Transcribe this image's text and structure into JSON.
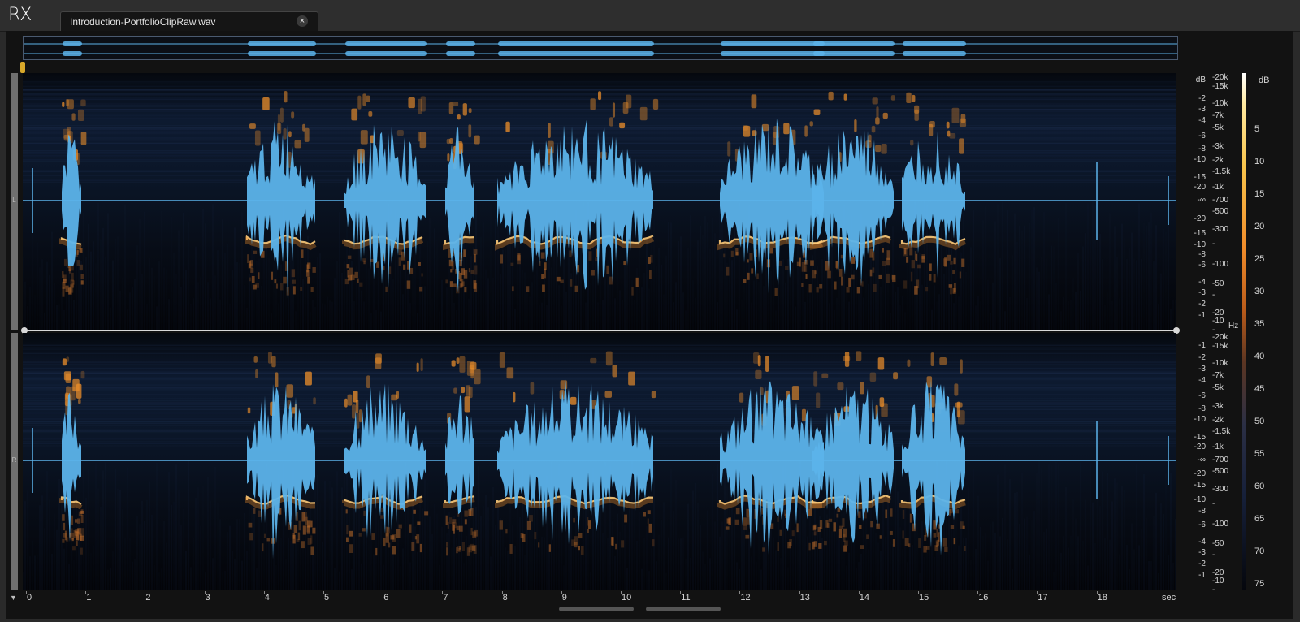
{
  "app": {
    "logo": "RX"
  },
  "tab": {
    "filename": "Introduction-PortfolioClipRaw.wav",
    "close_label": "×"
  },
  "channels": {
    "left_label": "L",
    "right_label": "R"
  },
  "db_axis": {
    "header": "dB",
    "left_ticks": [
      "-2",
      "-3",
      "-4",
      "-6",
      "-8",
      "-10",
      "-15",
      "-20",
      "-∞",
      "-20",
      "-15",
      "-10",
      "-8",
      "-6",
      "-4",
      "-3",
      "-2",
      "-1"
    ],
    "right_ticks": [
      "-1",
      "-2",
      "-3",
      "-4",
      "-6",
      "-8",
      "-10",
      "-15",
      "-20",
      "-∞",
      "-20",
      "-15",
      "-10",
      "-8",
      "-6",
      "-4",
      "-3",
      "-2",
      "-1"
    ]
  },
  "hz_axis": {
    "unit": "Hz",
    "left_ticks": [
      "-20k",
      "-15k",
      "-10k",
      "-7k",
      "-5k",
      "-3k",
      "-2k",
      "-1.5k",
      "-1k",
      "-700",
      "-500",
      "-300",
      "-",
      "-100",
      "-50",
      "-",
      "-20",
      "-10",
      "-"
    ],
    "right_ticks": [
      "-20k",
      "-15k",
      "-10k",
      "-7k",
      "-5k",
      "-3k",
      "-2k",
      "-1.5k",
      "-1k",
      "-700",
      "-500",
      "-300",
      "-",
      "-100",
      "-50",
      "-",
      "-20",
      "-10",
      "-"
    ]
  },
  "colorbar": {
    "header": "dB",
    "labels": [
      "5",
      "10",
      "15",
      "20",
      "25",
      "30",
      "35",
      "40",
      "45",
      "50",
      "55",
      "60",
      "65",
      "70",
      "75"
    ]
  },
  "time_axis": {
    "unit": "sec",
    "labels": [
      "0",
      "1",
      "2",
      "3",
      "4",
      "5",
      "6",
      "7",
      "8",
      "9",
      "10",
      "11",
      "12",
      "13",
      "14",
      "15",
      "16",
      "17",
      "18"
    ]
  },
  "colors": {
    "waveform": "#5cb3ea",
    "spectral_hot": "#f0902a",
    "background": "#05070c",
    "divider": "#d8d8d8"
  }
}
